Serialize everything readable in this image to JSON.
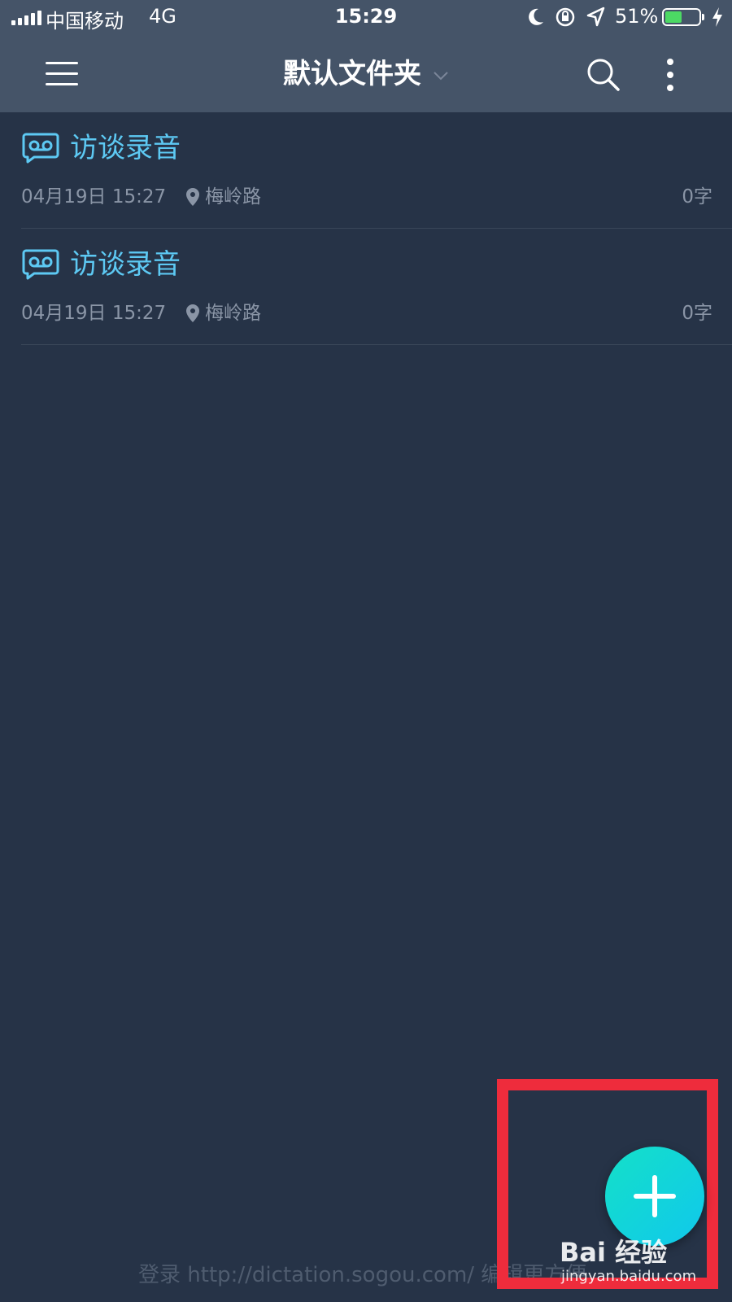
{
  "status_bar": {
    "carrier": "中国移动",
    "network": "4G",
    "time": "15:29",
    "battery_percent": "51%",
    "battery_level": 0.51,
    "icons": [
      "signal-icon",
      "moon-icon",
      "rotation-lock-icon",
      "location-arrow-icon",
      "battery-icon",
      "charging-icon"
    ]
  },
  "nav": {
    "title": "默认文件夹",
    "icons": [
      "menu-icon",
      "chevron-down-icon",
      "search-icon",
      "more-vertical-icon"
    ]
  },
  "list": {
    "items": [
      {
        "title": "访谈录音",
        "date": "04月19日 15:27",
        "location": "梅岭路",
        "count": "0字"
      },
      {
        "title": "访谈录音",
        "date": "04月19日 15:27",
        "location": "梅岭路",
        "count": "0字"
      }
    ]
  },
  "fab": {
    "icon": "plus-icon"
  },
  "footer": {
    "url_text": "登录 http://dictation.sogou.com/ 编辑更方便"
  },
  "watermark": {
    "logo": "Bai 经验",
    "url": "jingyan.baidu.com"
  },
  "colors": {
    "background": "#263347",
    "header": "#455468",
    "accent": "#5dc9f3",
    "fab": "#14d8d8",
    "highlight": "#ee2c3c"
  }
}
